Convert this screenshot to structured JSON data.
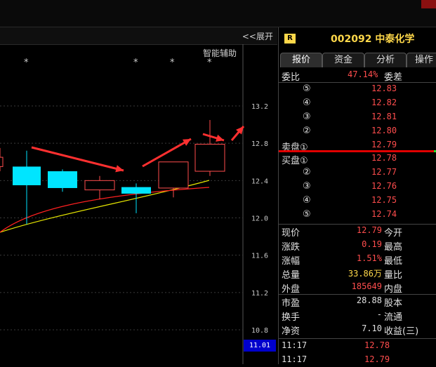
{
  "chart": {
    "expand_label": "<<展开",
    "aux_label": "智能辅助",
    "stars": [
      "*",
      "*",
      "*",
      "*"
    ],
    "price_ticks": [
      "13.2",
      "12.8",
      "12.4",
      "12.0",
      "11.6",
      "11.2",
      "10.8"
    ],
    "current_price": "11.01"
  },
  "chart_data": {
    "type": "candlestick",
    "y_ticks": [
      13.2,
      12.8,
      12.4,
      12.0,
      11.6,
      11.2,
      10.8
    ],
    "candles": [
      {
        "open": 12.65,
        "close": 12.55,
        "high": 12.75,
        "low": 12.5,
        "color": "up"
      },
      {
        "open": 12.55,
        "close": 12.35,
        "high": 12.72,
        "low": 11.93,
        "color": "down"
      },
      {
        "open": 12.5,
        "close": 12.32,
        "high": 12.52,
        "low": 12.28,
        "color": "down"
      },
      {
        "open": 12.4,
        "close": 12.3,
        "high": 12.45,
        "low": 12.2,
        "color": "up"
      },
      {
        "open": 12.33,
        "close": 12.26,
        "high": 12.37,
        "low": 12.05,
        "color": "down"
      },
      {
        "open": 12.32,
        "close": 12.6,
        "high": 12.6,
        "low": 12.22,
        "color": "up"
      },
      {
        "open": 12.5,
        "close": 12.79,
        "high": 13.05,
        "low": 12.45,
        "color": "up"
      }
    ],
    "colors": {
      "up": "#ff4d4d",
      "down": "#00e5ff",
      "ma1": "#e6e600",
      "ma2": "#ff2020",
      "arrow": "#ff3030"
    }
  },
  "panel": {
    "badge": "R",
    "title": "002092 中泰化学",
    "tabs": [
      "报价",
      "资金",
      "分析",
      "操作"
    ],
    "weibi_label": "委比",
    "weibi_value": "47.14%",
    "weicha_label": "委差",
    "sell": [
      {
        "mark": "⑤",
        "price": "12.83"
      },
      {
        "mark": "④",
        "price": "12.82"
      },
      {
        "mark": "③",
        "price": "12.81"
      },
      {
        "mark": "②",
        "price": "12.80"
      },
      {
        "mark": "卖盘①",
        "price": "12.79"
      }
    ],
    "buy": [
      {
        "mark": "买盘①",
        "price": "12.78"
      },
      {
        "mark": "②",
        "price": "12.77"
      },
      {
        "mark": "③",
        "price": "12.76"
      },
      {
        "mark": "④",
        "price": "12.75"
      },
      {
        "mark": "⑤",
        "price": "12.74"
      }
    ],
    "stats": [
      {
        "label": "现价",
        "value": "12.79",
        "right": "今开",
        "cls": "red"
      },
      {
        "label": "涨跌",
        "value": "0.19",
        "right": "最高",
        "cls": "red"
      },
      {
        "label": "涨幅",
        "value": "1.51%",
        "right": "最低",
        "cls": "red"
      },
      {
        "label": "总量",
        "value": "33.86万",
        "right": "量比",
        "cls": "yel"
      },
      {
        "label": "外盘",
        "value": "185649",
        "right": "内盘",
        "cls": "red"
      }
    ],
    "stats2": [
      {
        "label": "市盈",
        "value": "28.88",
        "right": "股本",
        "cls": "white"
      },
      {
        "label": "换手",
        "value": "-",
        "right": "流通",
        "cls": "white"
      },
      {
        "label": "净资",
        "value": "7.10",
        "right": "收益(三)",
        "cls": "white"
      }
    ],
    "ticks": [
      {
        "time": "11:17",
        "price": "12.78"
      },
      {
        "time": "11:17",
        "price": "12.79"
      }
    ]
  }
}
